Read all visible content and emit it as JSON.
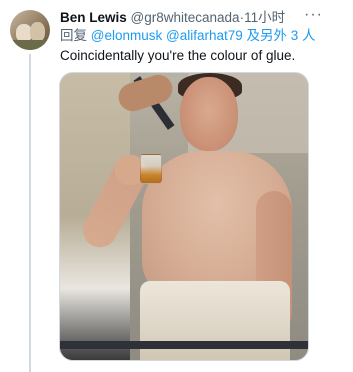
{
  "tweet": {
    "author": {
      "name": "Ben Lewis",
      "handle": "@gr8whitecanada",
      "separator": "·",
      "time": "11小时"
    },
    "more_label": "···",
    "reply_prefix": "回复",
    "reply_mentions": [
      "@elonmusk",
      "@alifarhat79"
    ],
    "reply_suffix": "及另外 3 人",
    "text": "Coincidentally you're the colour of glue."
  },
  "colors": {
    "link": "#1d9bf0",
    "secondary_text": "#536471",
    "primary_text": "#0f1419",
    "thread_line": "#cfd9de"
  }
}
